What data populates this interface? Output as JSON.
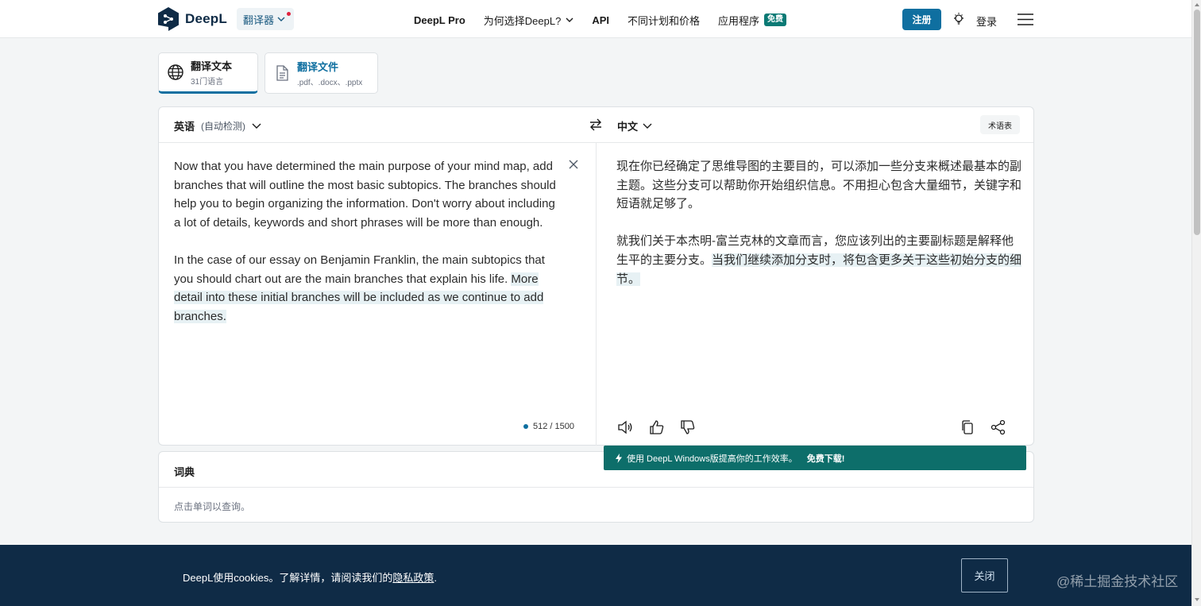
{
  "header": {
    "logo_text": "DeepL",
    "translator_label": "翻译器",
    "nav": [
      {
        "label": "DeepL Pro"
      },
      {
        "label": "为何选择DeepL?"
      },
      {
        "label": "API"
      },
      {
        "label": "不同计划和价格"
      },
      {
        "label": "应用程序"
      }
    ],
    "free_badge": "免费",
    "signup": "注册",
    "login": "登录"
  },
  "tabs": {
    "text": {
      "title": "翻译文本",
      "sub": "31门语言"
    },
    "file": {
      "title": "翻译文件",
      "sub": ".pdf、.docx、.pptx"
    }
  },
  "translator": {
    "source_lang": "英语",
    "detect_label": "(自动检测)",
    "target_lang": "中文",
    "glossary": "术语表",
    "source": {
      "p1": "Now that you have determined the main purpose of your mind map, add branches that will outline the most basic subtopics. The branches should help you to begin organizing the information. Don't worry about including a lot of details, keywords and short phrases will be more than enough.",
      "p2_plain": "In the case of our essay on Benjamin Franklin, the main subtopics that you should chart out are the main branches that explain his life. ",
      "p2_highlight": "More detail into these initial branches will be included as we continue to add branches."
    },
    "target": {
      "p1": "现在你已经确定了思维导图的主要目的，可以添加一些分支来概述最基本的副主题。这些分支可以帮助你开始组织信息。不用担心包含大量细节，关键字和短语就足够了。",
      "p2_plain": "就我们关于本杰明-富兰克林的文章而言，您应该列出的主要副标题是解释他生平的主要分支。",
      "p2_highlight": "当我们继续添加分支时，将包含更多关于这些初始分支的细节。"
    },
    "char_count": "512 / 1500"
  },
  "promo": {
    "text": "使用 DeepL Windows版提高你的工作效率。",
    "cta": "免费下载!"
  },
  "dictionary": {
    "title": "词典",
    "hint": "点击单词以查询。"
  },
  "cookie": {
    "text": "DeepL使用cookies。了解详情，请阅读我们的",
    "link": "隐私政策",
    "suffix": ".",
    "close": "关闭",
    "watermark": "@稀土掘金技术社区"
  },
  "colors": {
    "brand_dark": "#0f2b46",
    "accent_blue": "#0f6fa0",
    "teal": "#0d6e6a",
    "highlight": "#e7f1f4"
  }
}
